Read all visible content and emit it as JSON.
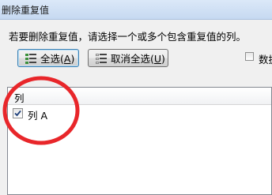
{
  "window": {
    "title": "删除重复值"
  },
  "instruction": "若要删除重复值，请选择一个或多个包含重复值的列。",
  "buttons": {
    "select_all": {
      "text": "全选(",
      "key": "A",
      "close": ")"
    },
    "unselect_all": {
      "text": "取消全选(",
      "key": "U",
      "close": ")"
    }
  },
  "options": {
    "has_headers_label": "数据"
  },
  "column_list": {
    "header": "列",
    "items": [
      {
        "label": "列 A",
        "checked": true
      }
    ]
  },
  "colors": {
    "annotation_circle": "#e8262a",
    "select_button_border": "#3c7fb1"
  }
}
